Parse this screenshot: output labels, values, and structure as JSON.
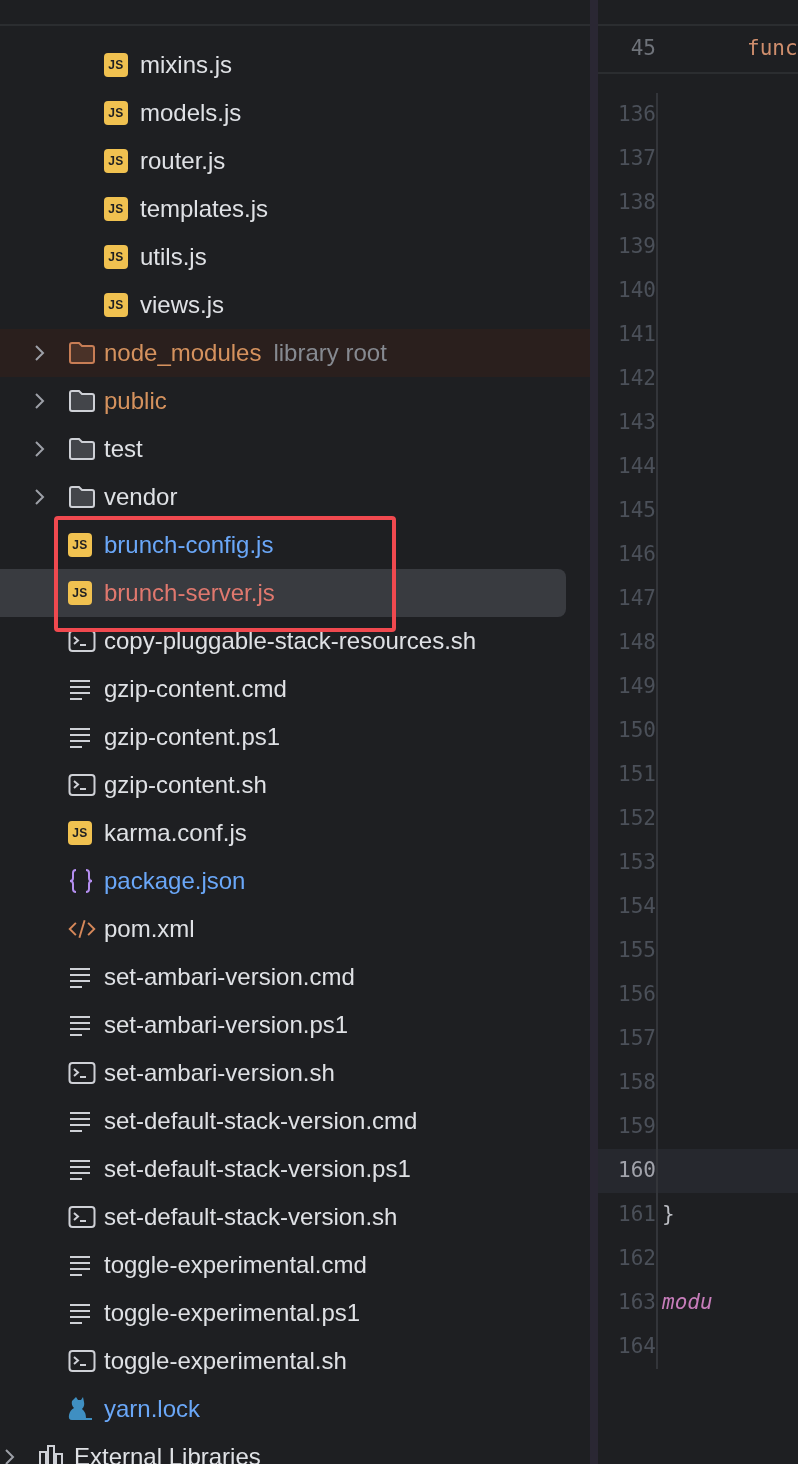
{
  "tree": [
    {
      "children": [
        {
          "children": [
            {
              "label": "mixins.js",
              "kind": "js",
              "icon_label": "JS",
              "color": "#dfe1e5",
              "selected": false
            },
            {
              "label": "models.js",
              "kind": "js",
              "icon_label": "JS",
              "color": "#dfe1e5",
              "selected": false
            },
            {
              "label": "router.js",
              "kind": "js",
              "icon_label": "JS",
              "color": "#dfe1e5",
              "selected": false
            },
            {
              "label": "templates.js",
              "kind": "js",
              "icon_label": "JS",
              "color": "#dfe1e5",
              "selected": false
            },
            {
              "label": "utils.js",
              "kind": "js",
              "icon_label": "JS",
              "color": "#dfe1e5",
              "selected": false
            },
            {
              "label": "views.js",
              "kind": "js",
              "icon_label": "JS",
              "color": "#dfe1e5",
              "selected": false
            }
          ]
        },
        {
          "label": "node_modules",
          "hint": "library root",
          "kind": "folder",
          "excluded": true,
          "expanded": false,
          "color": "#d5925e",
          "selected": false
        },
        {
          "label": "public",
          "kind": "folder",
          "excluded": false,
          "expanded": false,
          "color": "#d5925e",
          "selected": false
        },
        {
          "label": "test",
          "kind": "folder",
          "excluded": false,
          "expanded": false,
          "color": "#dfe1e5",
          "selected": false
        },
        {
          "label": "vendor",
          "kind": "folder",
          "excluded": false,
          "expanded": false,
          "color": "#dfe1e5",
          "selected": false
        },
        {
          "label": "brunch-config.js",
          "kind": "js",
          "icon_label": "JS",
          "color": "#6aa7f8",
          "selected": false
        },
        {
          "label": "brunch-server.js",
          "kind": "js",
          "icon_label": "JS",
          "color": "#e0786e",
          "selected": true
        },
        {
          "label": "copy-pluggable-stack-resources.sh",
          "kind": "shell",
          "color": "#dfe1e5",
          "selected": false
        },
        {
          "label": "gzip-content.cmd",
          "kind": "text",
          "color": "#dfe1e5",
          "selected": false
        },
        {
          "label": "gzip-content.ps1",
          "kind": "text",
          "color": "#dfe1e5",
          "selected": false
        },
        {
          "label": "gzip-content.sh",
          "kind": "shell",
          "color": "#dfe1e5",
          "selected": false
        },
        {
          "label": "karma.conf.js",
          "kind": "js",
          "icon_label": "JS",
          "color": "#dfe1e5",
          "selected": false
        },
        {
          "label": "package.json",
          "kind": "json",
          "color": "#6aa7f8",
          "selected": false
        },
        {
          "label": "pom.xml",
          "kind": "xml",
          "color": "#dfe1e5",
          "selected": false
        },
        {
          "label": "set-ambari-version.cmd",
          "kind": "text",
          "color": "#dfe1e5",
          "selected": false
        },
        {
          "label": "set-ambari-version.ps1",
          "kind": "text",
          "color": "#dfe1e5",
          "selected": false
        },
        {
          "label": "set-ambari-version.sh",
          "kind": "shell",
          "color": "#dfe1e5",
          "selected": false
        },
        {
          "label": "set-default-stack-version.cmd",
          "kind": "text",
          "color": "#dfe1e5",
          "selected": false
        },
        {
          "label": "set-default-stack-version.ps1",
          "kind": "text",
          "color": "#dfe1e5",
          "selected": false
        },
        {
          "label": "set-default-stack-version.sh",
          "kind": "shell",
          "color": "#dfe1e5",
          "selected": false
        },
        {
          "label": "toggle-experimental.cmd",
          "kind": "text",
          "color": "#dfe1e5",
          "selected": false
        },
        {
          "label": "toggle-experimental.ps1",
          "kind": "text",
          "color": "#dfe1e5",
          "selected": false
        },
        {
          "label": "toggle-experimental.sh",
          "kind": "shell",
          "color": "#dfe1e5",
          "selected": false
        },
        {
          "label": "yarn.lock",
          "kind": "yarn",
          "color": "#6aa7f8",
          "selected": false
        }
      ]
    },
    {
      "label": "External Libraries",
      "kind": "library",
      "expanded": false,
      "color": "#dfe1e5",
      "selected": false
    }
  ],
  "editor": {
    "sticky_line": {
      "number": "45",
      "code": "func",
      "color": "#cf8e6d",
      "italic": false
    },
    "lines": [
      {
        "number": "136",
        "current": false
      },
      {
        "number": "137",
        "current": false
      },
      {
        "number": "138",
        "current": false
      },
      {
        "number": "139",
        "current": false
      },
      {
        "number": "140",
        "current": false
      },
      {
        "number": "141",
        "current": false
      },
      {
        "number": "142",
        "current": false
      },
      {
        "number": "143",
        "current": false
      },
      {
        "number": "144",
        "current": false
      },
      {
        "number": "145",
        "current": false
      },
      {
        "number": "146",
        "current": false
      },
      {
        "number": "147",
        "current": false
      },
      {
        "number": "148",
        "current": false
      },
      {
        "number": "149",
        "current": false
      },
      {
        "number": "150",
        "current": false
      },
      {
        "number": "151",
        "current": false
      },
      {
        "number": "152",
        "current": false
      },
      {
        "number": "153",
        "current": false
      },
      {
        "number": "154",
        "current": false
      },
      {
        "number": "155",
        "current": false
      },
      {
        "number": "156",
        "current": false
      },
      {
        "number": "157",
        "current": false
      },
      {
        "number": "158",
        "current": false
      },
      {
        "number": "159",
        "current": false
      },
      {
        "number": "160",
        "current": true
      },
      {
        "number": "161",
        "current": false,
        "code": "}",
        "color": "#bcbec4",
        "italic": false
      },
      {
        "number": "162",
        "current": false
      },
      {
        "number": "163",
        "current": false,
        "code": "modu",
        "color": "#c77dbb",
        "italic": true
      },
      {
        "number": "164",
        "current": false
      }
    ]
  }
}
